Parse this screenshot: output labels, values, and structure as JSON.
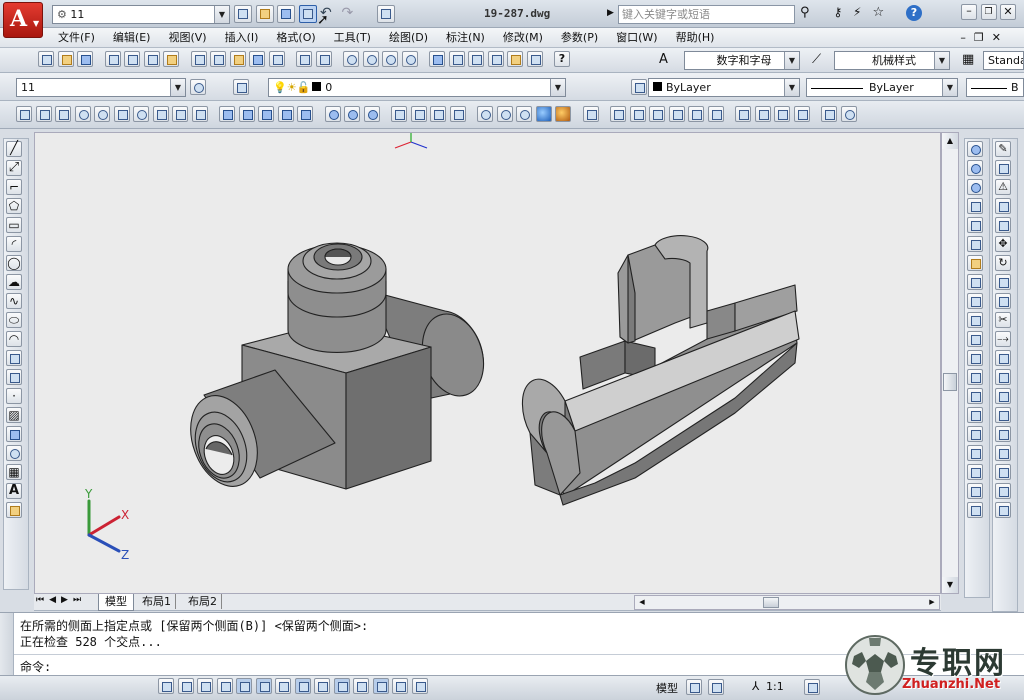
{
  "quick_access": {
    "workspace": "11",
    "file_title": "19-287.dwg",
    "search_placeholder": "键入关键字或短语"
  },
  "menu": [
    "文件(F)",
    "编辑(E)",
    "视图(V)",
    "插入(I)",
    "格式(O)",
    "工具(T)",
    "绘图(D)",
    "标注(N)",
    "修改(M)",
    "参数(P)",
    "窗口(W)",
    "帮助(H)"
  ],
  "styles": {
    "text_style": "数字和字母",
    "dim_style": "机械样式",
    "table_style": "Standa"
  },
  "layers": {
    "layer_name": "11",
    "current_layer": "0",
    "color": "ByLayer",
    "linetype": "ByLayer",
    "lineweight": "B"
  },
  "tabs": [
    "模型",
    "布局1",
    "布局2"
  ],
  "command": {
    "line1": "在所需的侧面上指定点或 [保留两个侧面(B)] <保留两个侧面>:",
    "line2": "正在检查 528 个交点...",
    "prompt": "命令:"
  },
  "status": {
    "model": "模型",
    "scale": "1:1"
  },
  "axis": {
    "x": "X",
    "y": "Y",
    "z": "Z"
  },
  "watermark": {
    "brand": "专职网",
    "url": "Zhuanzhi.Net"
  },
  "colors": {
    "drawing_bg": "#ebebeb",
    "model_gray": "#8a8a8a",
    "app_red": "#c8261e"
  }
}
